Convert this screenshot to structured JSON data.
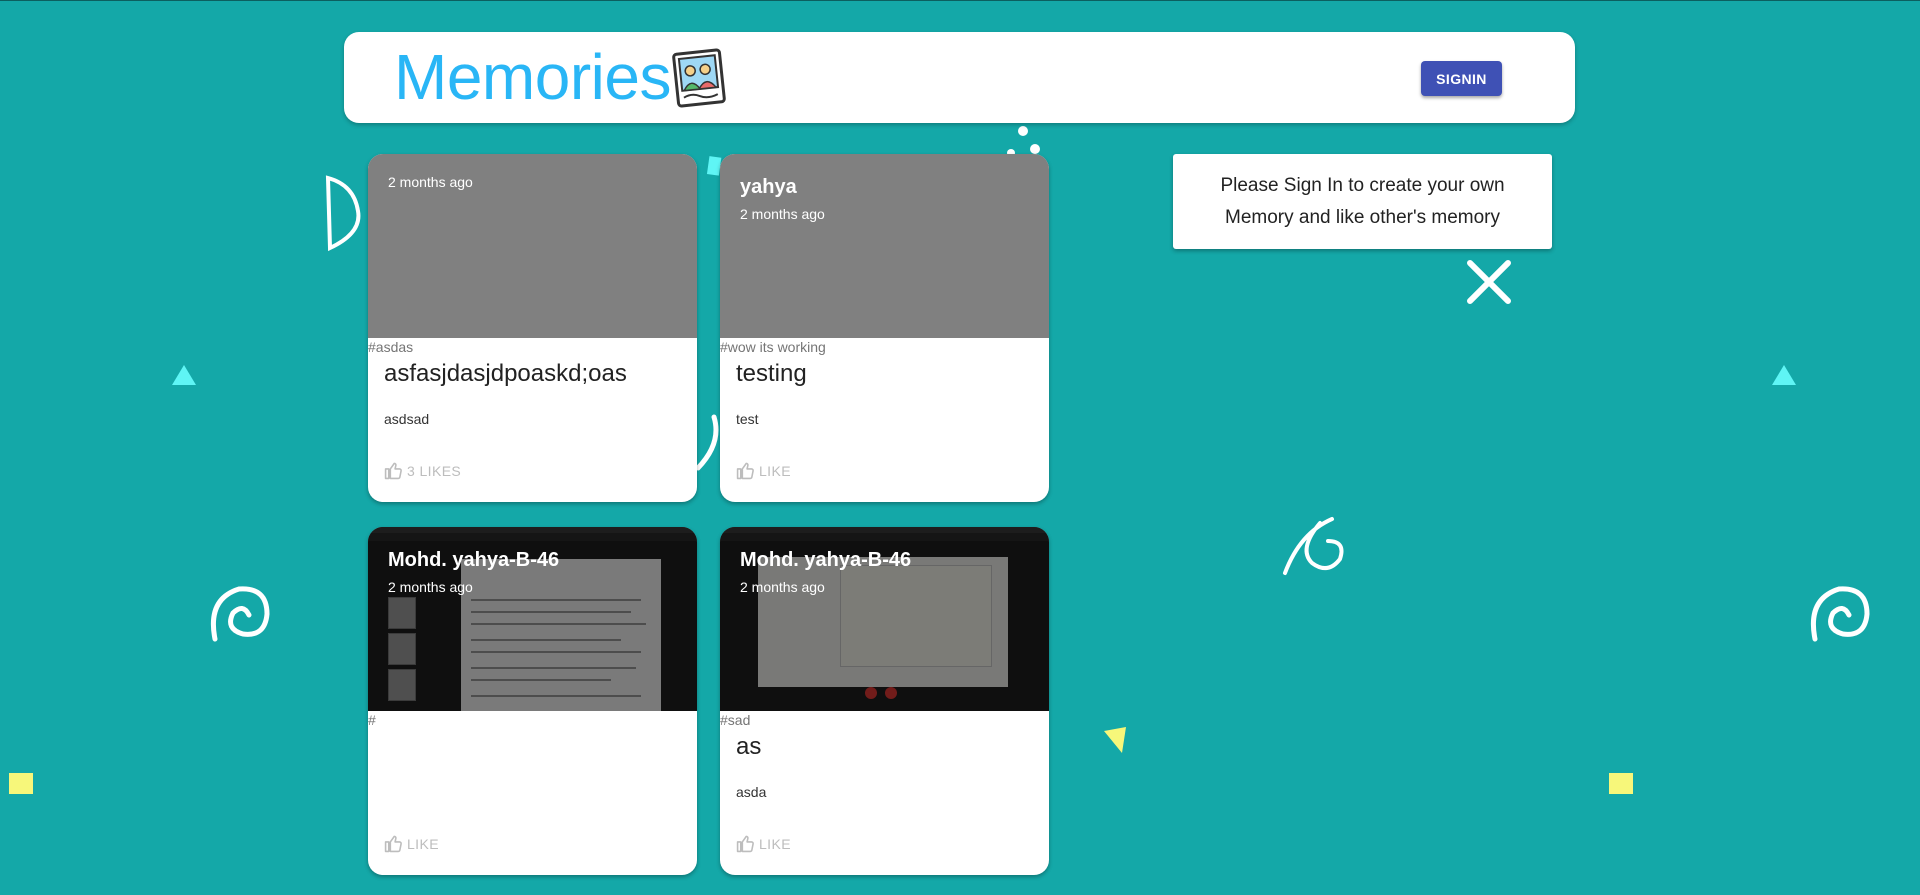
{
  "app": {
    "title": "Memories",
    "signin_label": "SIGNIN"
  },
  "posts": [
    {
      "creator": "",
      "time": "2 months ago",
      "tags": "#asdas",
      "title": "asfasjdasjdpoaskd;oas",
      "message": "asdsad",
      "likes_label": "3 LIKES"
    },
    {
      "creator": "yahya",
      "time": "2 months ago",
      "tags": "#wow its working",
      "title": "testing",
      "message": "test",
      "likes_label": "LIKE"
    },
    {
      "creator": "Mohd. yahya-B-46",
      "time": "2 months ago",
      "tags": "#",
      "title": "",
      "message": "",
      "likes_label": "LIKE"
    },
    {
      "creator": "Mohd. yahya-B-46",
      "time": "2 months ago",
      "tags": "#sad",
      "title": "as",
      "message": "asda",
      "likes_label": "LIKE"
    }
  ],
  "signin_prompt": "Please Sign In to create your own Memory and like other's memory",
  "colors": {
    "background": "#14a8a8",
    "brand": "#29b6f6",
    "button": "#3f51b5"
  }
}
